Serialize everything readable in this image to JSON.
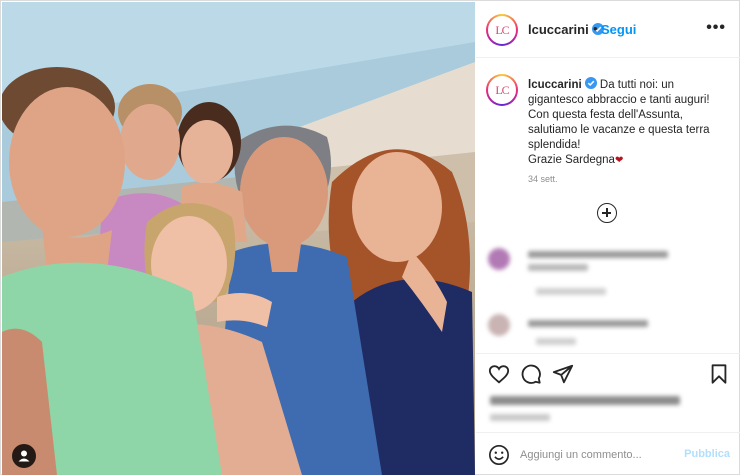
{
  "post": {
    "username": "lcuccarini",
    "avatar_initials": "LC",
    "separator": "•",
    "follow_label": "Segui",
    "more_label": "•••",
    "caption_text": "Da tutti noi: un gigantesco abbraccio e tanti auguri! Con questa festa dell'Assunta, salutiamo le vacanze e questa terra splendida!\nGrazie Sardegna",
    "caption_emoji": "❤",
    "age": "34 sett.",
    "comment_placeholder": "Aggiungi un commento...",
    "publish_label": "Pubblica"
  },
  "icons": {
    "verified": "verified-badge-icon",
    "like": "heart-outline-icon",
    "comment": "speech-bubble-icon",
    "share": "paper-plane-icon",
    "save": "bookmark-icon",
    "emoji": "smiley-icon",
    "load_more": "plus-circle-icon",
    "tag": "user-tag-icon"
  },
  "colors": {
    "accent_blue": "#0095f6",
    "verified_blue": "#3897f0",
    "publish_disabled": "#b2dffc",
    "muted_text": "#8e8e8e",
    "border": "#dbdbdb"
  }
}
